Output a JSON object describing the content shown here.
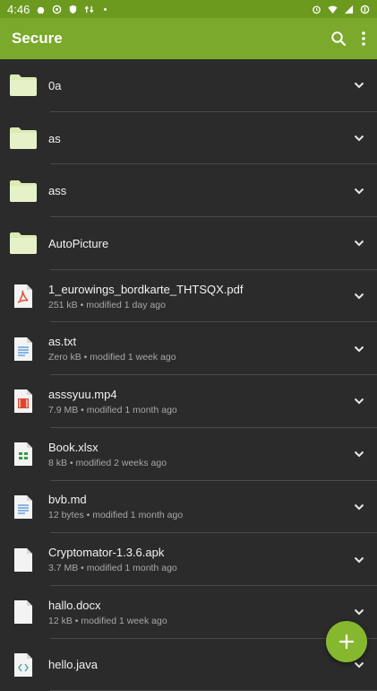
{
  "status_bar": {
    "time": "4:46"
  },
  "app_bar": {
    "title": "Secure"
  },
  "colors": {
    "status_bar": "#6b9a1e",
    "app_bar": "#7aa92b",
    "fab": "#86b82f",
    "background": "#2b2b2b"
  },
  "items": [
    {
      "name": "0a",
      "meta": "",
      "icon": "folder-icon"
    },
    {
      "name": "as",
      "meta": "",
      "icon": "folder-icon"
    },
    {
      "name": "ass",
      "meta": "",
      "icon": "folder-icon"
    },
    {
      "name": "AutoPicture",
      "meta": "",
      "icon": "folder-icon"
    },
    {
      "name": "1_eurowings_bordkarte_THTSQX.pdf",
      "meta": "251 kB • modified 1 day ago",
      "icon": "pdf-file-icon"
    },
    {
      "name": "as.txt",
      "meta": "Zero kB • modified 1 week ago",
      "icon": "text-file-icon"
    },
    {
      "name": "asssyuu.mp4",
      "meta": "7.9 MB • modified 1 month ago",
      "icon": "video-file-icon"
    },
    {
      "name": "Book.xlsx",
      "meta": "8 kB • modified 2 weeks ago",
      "icon": "spreadsheet-file-icon"
    },
    {
      "name": "bvb.md",
      "meta": "12 bytes • modified 1 month ago",
      "icon": "text-file-icon"
    },
    {
      "name": "Cryptomator-1.3.6.apk",
      "meta": "3.7 MB • modified 1 month ago",
      "icon": "file-icon"
    },
    {
      "name": "hallo.docx",
      "meta": "12 kB • modified 1 week ago",
      "icon": "file-icon"
    },
    {
      "name": "hello.java",
      "meta": "",
      "icon": "code-file-icon"
    }
  ]
}
